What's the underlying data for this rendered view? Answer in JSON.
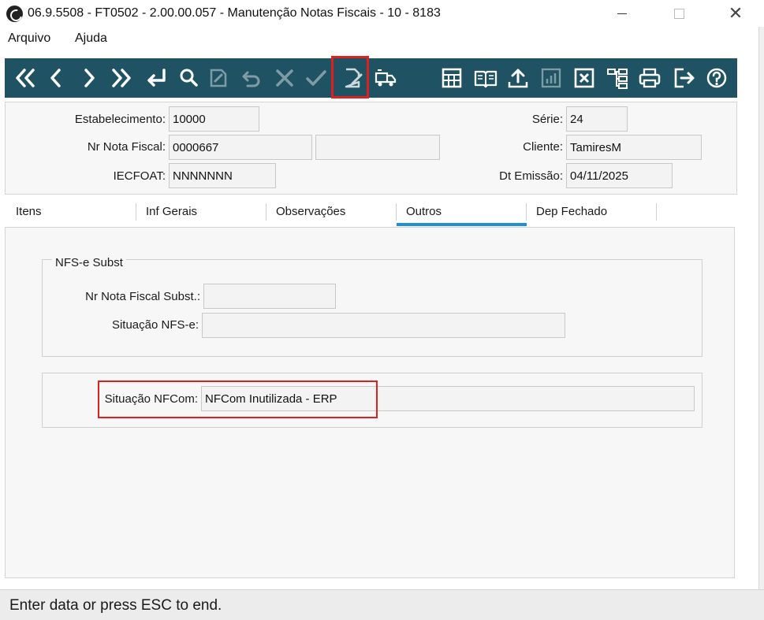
{
  "window": {
    "title": "06.9.5508 - FT0502 - 2.00.00.057 - Manutenção Notas Fiscais - 10 - 8183",
    "close_glyph": "✕"
  },
  "menu": {
    "items": [
      {
        "label": "Arquivo"
      },
      {
        "label": "Ajuda"
      }
    ]
  },
  "toolbar": {
    "background": "#1f5363",
    "icon_color": "#ffffff",
    "disabled_color": "#7f9ca6",
    "highlight_color": "#e0201e",
    "buttons": [
      {
        "icon": "first-record-icon"
      },
      {
        "icon": "previous-record-icon"
      },
      {
        "icon": "next-record-icon"
      },
      {
        "icon": "last-record-icon"
      },
      {
        "icon": "goto-return-icon"
      },
      {
        "icon": "search-icon"
      },
      {
        "icon": "edit-icon",
        "disabled": true
      },
      {
        "icon": "undo-icon",
        "disabled": true
      },
      {
        "icon": "cancel-icon",
        "disabled": true
      },
      {
        "icon": "confirm-icon",
        "disabled": true
      },
      {
        "icon": "document-edit-icon",
        "highlighted": true
      },
      {
        "icon": "truck-icon"
      },
      {
        "icon": "calculator-icon"
      },
      {
        "icon": "book-icon"
      },
      {
        "icon": "upload-icon"
      },
      {
        "icon": "chart-icon",
        "disabled": true
      },
      {
        "icon": "excel-icon"
      },
      {
        "icon": "tree-icon"
      },
      {
        "icon": "print-icon"
      },
      {
        "icon": "exit-icon"
      },
      {
        "icon": "help-icon"
      }
    ]
  },
  "header": {
    "estabelecimento": {
      "label": "Estabelecimento:",
      "value": "10000"
    },
    "nr_nota_fiscal": {
      "label": "Nr Nota Fiscal:",
      "value": "0000667",
      "value2": ""
    },
    "iecfoat": {
      "label": "IECFOAT:",
      "value": "NNNNNNN"
    },
    "serie": {
      "label": "Série:",
      "value": "24"
    },
    "cliente": {
      "label": "Cliente:",
      "value": "TamiresM"
    },
    "dt_emissao": {
      "label": "Dt Emissão:",
      "value": "04/11/2025"
    }
  },
  "tabs": [
    {
      "label": "Itens"
    },
    {
      "label": "Inf  Gerais"
    },
    {
      "label": "Observações"
    },
    {
      "label": "Outros",
      "active": true
    },
    {
      "label": "Dep Fechado"
    }
  ],
  "outros": {
    "nfse_group": {
      "title": "NFS-e Subst",
      "nr_nota_fiscal_subst": {
        "label": "Nr Nota Fiscal Subst.:",
        "value": ""
      },
      "situacao_nfse": {
        "label": "Situação NFS-e:",
        "value": ""
      }
    },
    "nfcom_group": {
      "situacao_nfcom": {
        "label": "Situação NFCom:",
        "value": "NFCom Inutilizada - ERP"
      }
    }
  },
  "status": {
    "text": "Enter data or press ESC to end."
  }
}
